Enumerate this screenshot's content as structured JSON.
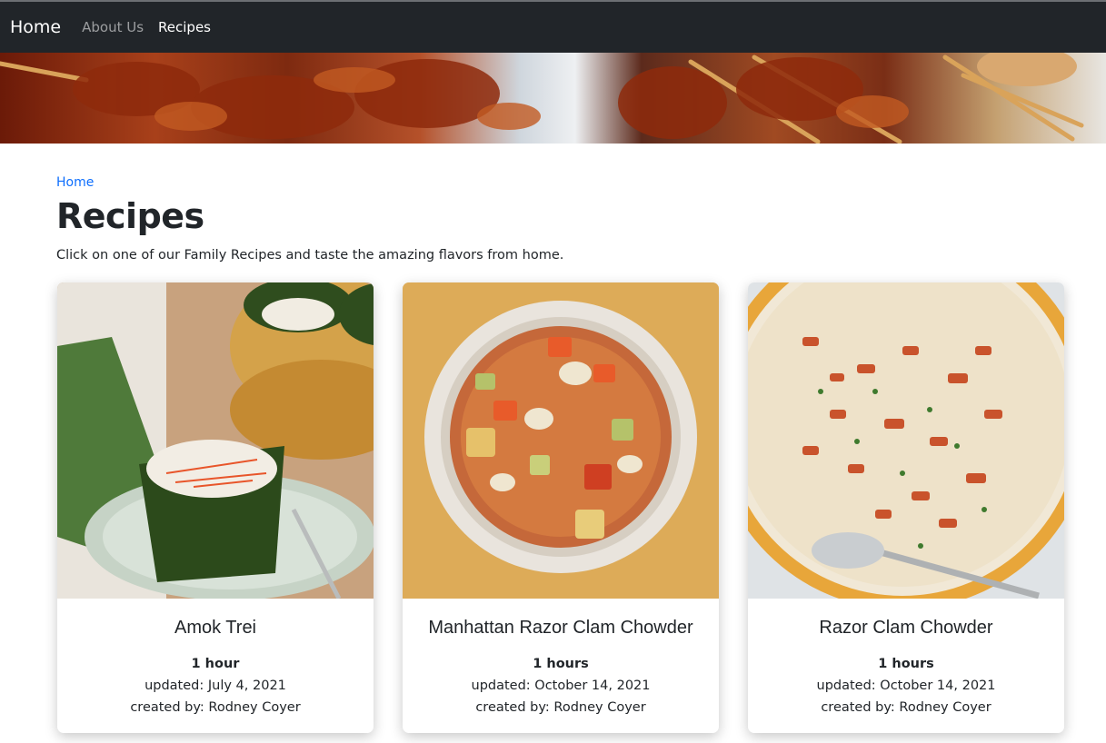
{
  "navbar": {
    "brand": "Home",
    "links": [
      {
        "label": "About Us",
        "active": false
      },
      {
        "label": "Recipes",
        "active": true
      }
    ]
  },
  "breadcrumb": "Home",
  "page": {
    "title": "Recipes",
    "subtitle": "Click on one of our Family Recipes and taste the amazing flavors from home."
  },
  "recipes": [
    {
      "title": "Amok Trei",
      "time": "1 hour",
      "updated": "updated: July 4, 2021",
      "created": "created by: Rodney Coyer"
    },
    {
      "title": "Manhattan Razor Clam Chowder",
      "time": "1 hours",
      "updated": "updated: October 14, 2021",
      "created": "created by: Rodney Coyer"
    },
    {
      "title": "Razor Clam Chowder",
      "time": "1 hours",
      "updated": "updated: October 14, 2021",
      "created": "created by: Rodney Coyer"
    }
  ],
  "colors": {
    "navbar_bg": "#212529",
    "link_blue": "#0d6efd",
    "text": "#212529"
  }
}
